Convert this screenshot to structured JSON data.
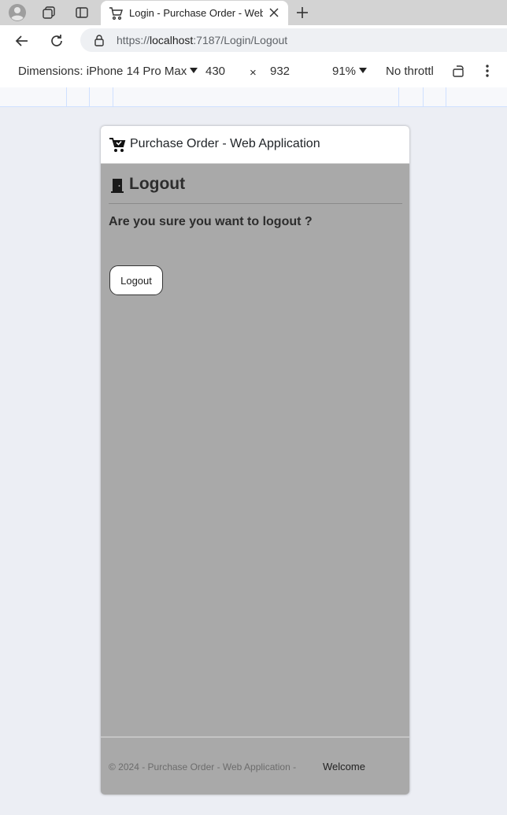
{
  "browser": {
    "tab": {
      "title": "Login - Purchase Order - Web Application"
    },
    "address": {
      "url_scheme": "https://",
      "url_host": "localhost",
      "url_path": ":7187/Login/Logout"
    }
  },
  "devtools": {
    "dimensions_label": "Dimensions: iPhone 14 Pro Max",
    "width": "430",
    "times": "×",
    "height": "932",
    "zoom": "91%",
    "throttle": "No throttl"
  },
  "app": {
    "title": "Purchase Order - Web Application",
    "page_heading": "Logout",
    "question": "Are you sure you want to logout ?",
    "logout_button": "Logout",
    "footer": {
      "copyright": "© 2024 - Purchase Order - Web Application -",
      "welcome": "Welcome"
    }
  },
  "icons": [
    "profile-icon",
    "workspaces-icon",
    "tab-actions-icon",
    "cart-icon",
    "close-icon",
    "new-tab-icon",
    "back-icon",
    "reload-icon",
    "lock-icon",
    "rotate-icon",
    "more-icon",
    "door-icon"
  ]
}
